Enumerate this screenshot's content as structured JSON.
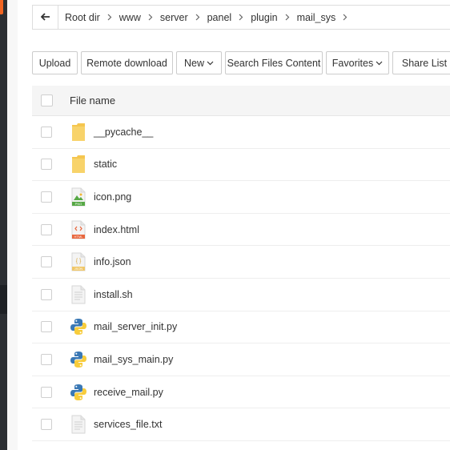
{
  "breadcrumb": {
    "back_icon": "arrow-left-icon",
    "items": [
      "Root dir",
      "www",
      "server",
      "panel",
      "plugin",
      "mail_sys"
    ]
  },
  "toolbar": {
    "upload": "Upload",
    "remote_download": "Remote download",
    "new": "New",
    "search_files_content": "Search Files Content",
    "favorites": "Favorites",
    "share_list": "Share List"
  },
  "table": {
    "header": "File name",
    "files": [
      {
        "name": "__pycache__",
        "icon": "folder-icon"
      },
      {
        "name": "static",
        "icon": "folder-icon"
      },
      {
        "name": "icon.png",
        "icon": "png-file-icon"
      },
      {
        "name": "index.html",
        "icon": "html-file-icon"
      },
      {
        "name": "info.json",
        "icon": "json-file-icon"
      },
      {
        "name": "install.sh",
        "icon": "text-file-icon"
      },
      {
        "name": "mail_server_init.py",
        "icon": "python-file-icon"
      },
      {
        "name": "mail_sys_main.py",
        "icon": "python-file-icon"
      },
      {
        "name": "receive_mail.py",
        "icon": "python-file-icon"
      },
      {
        "name": "services_file.txt",
        "icon": "text-file-icon"
      }
    ]
  },
  "icon_labels": {
    "png": "PNG",
    "html": "HTML",
    "json": "JSON"
  },
  "colors": {
    "folder": "#f5c64f",
    "python_blue": "#3a78b5",
    "python_yellow": "#f7cc3c",
    "html_orange": "#e8663d",
    "png_green": "#56a845"
  }
}
